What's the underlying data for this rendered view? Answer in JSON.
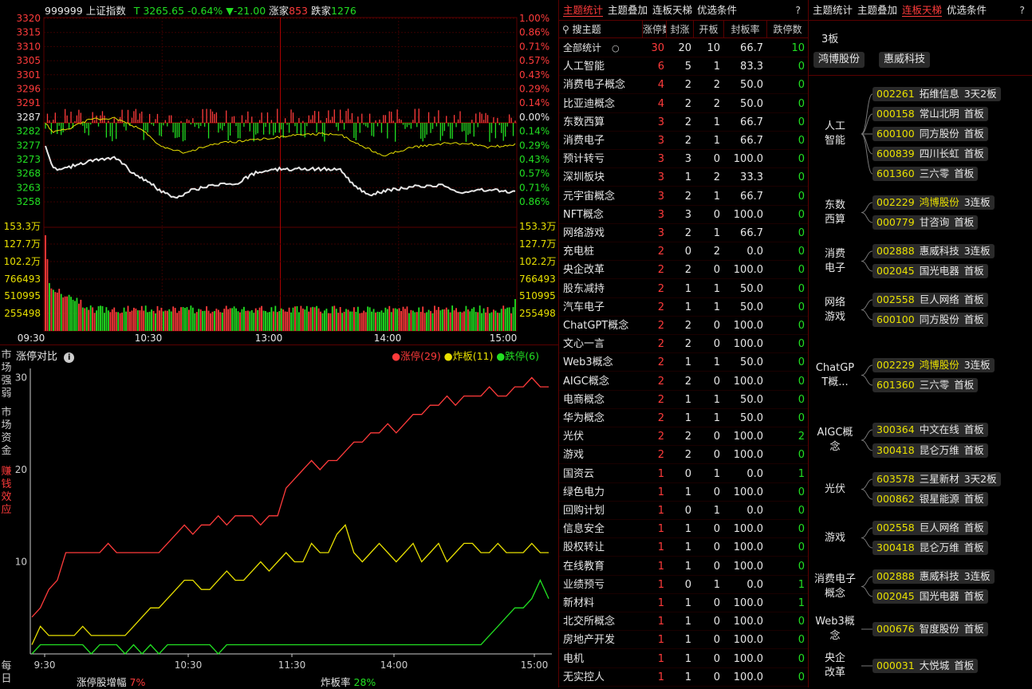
{
  "header": {
    "code": "999999",
    "name": "上证指数",
    "t_label": "T",
    "price": "3265.65",
    "change_pct": "-0.64%",
    "change": "▼-21.00",
    "up_label": "涨家",
    "up_count": "853",
    "down_label": "跌家",
    "down_count": "1276"
  },
  "price_axis_left": [
    "3320",
    "3315",
    "3310",
    "3305",
    "3301",
    "3296",
    "3291",
    "3287",
    "3282",
    "3277",
    "3273",
    "3268",
    "3263",
    "3258"
  ],
  "pct_axis_right": [
    "1.00%",
    "0.86%",
    "0.71%",
    "0.57%",
    "0.43%",
    "0.29%",
    "0.14%",
    "0.00%",
    "0.14%",
    "0.29%",
    "0.43%",
    "0.57%",
    "0.71%",
    "0.86%"
  ],
  "vol_axis_left": [
    "153.3万",
    "127.7万",
    "102.2万",
    "766493",
    "510995",
    "255498"
  ],
  "vol_axis_right": [
    "153.3万",
    "127.7万",
    "102.2万",
    "766493",
    "510995",
    "255498"
  ],
  "time_axis": [
    "09:30",
    "10:30",
    "13:00",
    "14:00",
    "15:00"
  ],
  "colors": {
    "up": "#ff3b3b",
    "down": "#22e022",
    "neutral": "#e6e6e6",
    "yellow": "#e8e000",
    "border": "#5a0000"
  },
  "lower": {
    "title": "涨停对比",
    "info_icon": "info-icon",
    "legend": [
      {
        "label": "涨停(29)",
        "color": "#ff3b3b"
      },
      {
        "label": "炸板(11)",
        "color": "#e8e000"
      },
      {
        "label": "跌停(6)",
        "color": "#22e022"
      }
    ],
    "side_tabs": [
      "市场强弱",
      "市场资金",
      "赚钱效应",
      "每日"
    ],
    "yticks": [
      "30",
      "20",
      "10"
    ],
    "xticks": [
      "9:30",
      "10:30",
      "11:30",
      "14:00",
      "15:00"
    ],
    "footer": [
      {
        "label": "涨停股增幅",
        "value": "7%"
      },
      {
        "label": "炸板率",
        "value": "28%"
      }
    ]
  },
  "chart_data": {
    "type": "line",
    "x": [
      "9:30",
      "10:30",
      "11:30",
      "14:00",
      "15:00"
    ],
    "ylim": [
      0,
      31
    ],
    "series": [
      {
        "name": "涨停",
        "color": "#ff3b3b",
        "values": [
          4,
          5,
          7,
          8,
          11,
          11,
          11,
          11,
          11,
          12,
          11,
          11,
          11,
          11,
          11,
          11,
          12,
          13,
          14,
          13,
          14,
          14,
          15,
          14,
          15,
          15,
          15,
          14,
          15,
          15,
          18,
          19,
          20,
          21,
          20,
          21,
          21,
          22,
          23,
          23,
          24,
          24,
          25,
          24,
          25,
          26,
          26,
          27,
          27,
          28,
          27,
          28,
          28,
          28,
          29,
          28,
          28,
          29,
          29,
          30,
          29,
          29
        ]
      },
      {
        "name": "炸板",
        "color": "#e8e000",
        "values": [
          1,
          3,
          2,
          2,
          2,
          2,
          3,
          2,
          2,
          2,
          2,
          2,
          3,
          4,
          5,
          5,
          6,
          7,
          8,
          8,
          7,
          7,
          8,
          9,
          8,
          8,
          9,
          10,
          9,
          10,
          11,
          10,
          10,
          12,
          11,
          11,
          13,
          14,
          11,
          10,
          11,
          12,
          11,
          10,
          11,
          12,
          10,
          11,
          12,
          10,
          11,
          12,
          12,
          11,
          11,
          12,
          11,
          11,
          11,
          12,
          11,
          11
        ]
      },
      {
        "name": "跌停",
        "color": "#22e022",
        "values": [
          0,
          1,
          1,
          1,
          1,
          1,
          1,
          0,
          1,
          1,
          1,
          0,
          1,
          0,
          1,
          0,
          1,
          1,
          1,
          1,
          1,
          1,
          0,
          1,
          1,
          1,
          1,
          1,
          1,
          1,
          1,
          1,
          1,
          1,
          1,
          1,
          1,
          1,
          1,
          1,
          1,
          1,
          1,
          1,
          1,
          1,
          1,
          1,
          1,
          1,
          1,
          1,
          1,
          1,
          2,
          3,
          4,
          5,
          5,
          6,
          8,
          6
        ]
      }
    ]
  },
  "mid": {
    "tabs": [
      "主题统计",
      "主题叠加",
      "连板天梯",
      "优选条件"
    ],
    "help": "?",
    "search": "搜主题",
    "cols": [
      "涨停数↓",
      "封涨",
      "开板",
      "封板率",
      "跌停数"
    ],
    "rows": [
      [
        "全部统计",
        "30",
        "20",
        "10",
        "66.7",
        "10"
      ],
      [
        "人工智能",
        "6",
        "5",
        "1",
        "83.3",
        "0"
      ],
      [
        "消费电子概念",
        "4",
        "2",
        "2",
        "50.0",
        "0"
      ],
      [
        "比亚迪概念",
        "4",
        "2",
        "2",
        "50.0",
        "0"
      ],
      [
        "东数西算",
        "3",
        "2",
        "1",
        "66.7",
        "0"
      ],
      [
        "消费电子",
        "3",
        "2",
        "1",
        "66.7",
        "0"
      ],
      [
        "预计转亏",
        "3",
        "3",
        "0",
        "100.0",
        "0"
      ],
      [
        "深圳板块",
        "3",
        "1",
        "2",
        "33.3",
        "0"
      ],
      [
        "元宇宙概念",
        "3",
        "2",
        "1",
        "66.7",
        "0"
      ],
      [
        "NFT概念",
        "3",
        "3",
        "0",
        "100.0",
        "0"
      ],
      [
        "网络游戏",
        "3",
        "2",
        "1",
        "66.7",
        "0"
      ],
      [
        "充电桩",
        "2",
        "0",
        "2",
        "0.0",
        "0"
      ],
      [
        "央企改革",
        "2",
        "2",
        "0",
        "100.0",
        "0"
      ],
      [
        "股东减持",
        "2",
        "1",
        "1",
        "50.0",
        "0"
      ],
      [
        "汽车电子",
        "2",
        "1",
        "1",
        "50.0",
        "0"
      ],
      [
        "ChatGPT概念",
        "2",
        "2",
        "0",
        "100.0",
        "0"
      ],
      [
        "文心一言",
        "2",
        "2",
        "0",
        "100.0",
        "0"
      ],
      [
        "Web3概念",
        "2",
        "1",
        "1",
        "50.0",
        "0"
      ],
      [
        "AIGC概念",
        "2",
        "2",
        "0",
        "100.0",
        "0"
      ],
      [
        "电商概念",
        "2",
        "1",
        "1",
        "50.0",
        "0"
      ],
      [
        "华为概念",
        "2",
        "1",
        "1",
        "50.0",
        "0"
      ],
      [
        "光伏",
        "2",
        "2",
        "0",
        "100.0",
        "2"
      ],
      [
        "游戏",
        "2",
        "2",
        "0",
        "100.0",
        "0"
      ],
      [
        "国资云",
        "1",
        "0",
        "1",
        "0.0",
        "1"
      ],
      [
        "绿色电力",
        "1",
        "1",
        "0",
        "100.0",
        "0"
      ],
      [
        "回购计划",
        "1",
        "0",
        "1",
        "0.0",
        "0"
      ],
      [
        "信息安全",
        "1",
        "1",
        "0",
        "100.0",
        "0"
      ],
      [
        "股权转让",
        "1",
        "1",
        "0",
        "100.0",
        "0"
      ],
      [
        "在线教育",
        "1",
        "1",
        "0",
        "100.0",
        "0"
      ],
      [
        "业绩预亏",
        "1",
        "0",
        "1",
        "0.0",
        "1"
      ],
      [
        "新材料",
        "1",
        "1",
        "0",
        "100.0",
        "1"
      ],
      [
        "北交所概念",
        "1",
        "1",
        "0",
        "100.0",
        "0"
      ],
      [
        "房地产开发",
        "1",
        "1",
        "0",
        "100.0",
        "0"
      ],
      [
        "电机",
        "1",
        "1",
        "0",
        "100.0",
        "0"
      ],
      [
        "无实控人",
        "1",
        "1",
        "0",
        "100.0",
        "0"
      ]
    ]
  },
  "right": {
    "tabs": [
      "主题统计",
      "主题叠加",
      "连板天梯",
      "优选条件"
    ],
    "help": "?",
    "top_label": "3板",
    "top_stocks": [
      "鸿博股份",
      "惠威科技"
    ],
    "groups": [
      {
        "label": "人工智能",
        "stocks": [
          [
            "002261",
            "拓维信息",
            "3天2板",
            false
          ],
          [
            "000158",
            "常山北明",
            "首板",
            false
          ],
          [
            "600100",
            "同方股份",
            "首板",
            false
          ],
          [
            "600839",
            "四川长虹",
            "首板",
            false
          ],
          [
            "601360",
            "三六零",
            "首板",
            false
          ]
        ]
      },
      {
        "label": "东数西算",
        "stocks": [
          [
            "002229",
            "鸿博股份",
            "3连板",
            true
          ],
          [
            "000779",
            "甘咨询",
            "首板",
            false
          ]
        ]
      },
      {
        "label": "消费电子",
        "stocks": [
          [
            "002888",
            "惠威科技",
            "3连板",
            false
          ],
          [
            "002045",
            "国光电器",
            "首板",
            false
          ]
        ]
      },
      {
        "label": "网络游戏",
        "stocks": [
          [
            "002558",
            "巨人网络",
            "首板",
            false
          ],
          [
            "600100",
            "同方股份",
            "首板",
            false
          ]
        ]
      },
      {
        "label": "ChatGPT概...",
        "stocks": [
          [
            "002229",
            "鸿博股份",
            "3连板",
            true
          ],
          [
            "601360",
            "三六零",
            "首板",
            false
          ]
        ]
      },
      {
        "label": "AIGC概念",
        "stocks": [
          [
            "300364",
            "中文在线",
            "首板",
            false
          ],
          [
            "300418",
            "昆仑万维",
            "首板",
            false
          ]
        ]
      },
      {
        "label": "光伏",
        "stocks": [
          [
            "603578",
            "三星新材",
            "3天2板",
            false
          ],
          [
            "000862",
            "银星能源",
            "首板",
            false
          ]
        ]
      },
      {
        "label": "游戏",
        "stocks": [
          [
            "002558",
            "巨人网络",
            "首板",
            false
          ],
          [
            "300418",
            "昆仑万维",
            "首板",
            false
          ]
        ]
      },
      {
        "label": "消费电子概念",
        "stocks": [
          [
            "002888",
            "惠威科技",
            "3连板",
            false
          ],
          [
            "002045",
            "国光电器",
            "首板",
            false
          ]
        ]
      },
      {
        "label": "Web3概念",
        "stocks": [
          [
            "000676",
            "智度股份",
            "首板",
            false
          ]
        ]
      },
      {
        "label": "央企改革",
        "stocks": [
          [
            "000031",
            "大悦城",
            "首板",
            false
          ]
        ]
      }
    ]
  }
}
